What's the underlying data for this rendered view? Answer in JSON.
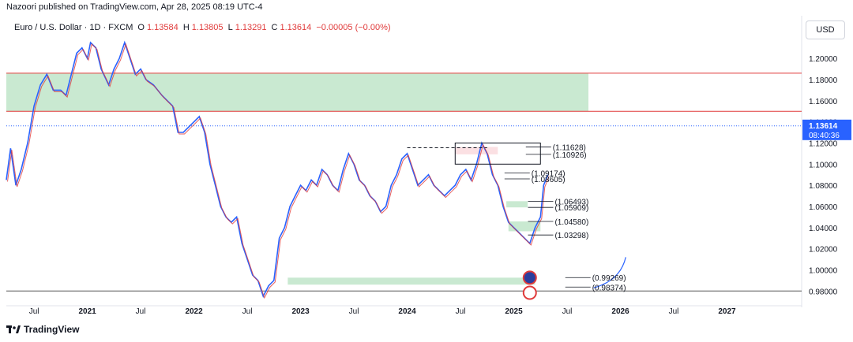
{
  "publisher_line": "Nazoori published on TradingView.com, Apr 28, 2025 08:19 UTC-4",
  "legend": {
    "symbol": "Euro / U.S. Dollar · 1D · FXCM",
    "o_label": "O",
    "o_val": "1.13584",
    "h_label": "H",
    "h_val": "1.13805",
    "l_label": "L",
    "l_val": "1.13291",
    "c_label": "C",
    "c_val": "1.13614",
    "change": "−0.00005 (−0.00%)"
  },
  "currency_button": "USD",
  "branding": "TradingView",
  "colors": {
    "up": "#2962ff",
    "down": "#e03a3a",
    "zone_green": "#b7e1c1",
    "zone_pink": "#f9d6d9",
    "line_red": "#e03a3a",
    "last_price_bg": "#2962ff"
  },
  "chart_data": {
    "type": "line",
    "ylim": [
      0.972,
      1.218
    ],
    "y_ticks": [
      "1.20000",
      "1.18000",
      "1.16000",
      "1.14000",
      "1.12000",
      "1.10000",
      "1.08000",
      "1.06000",
      "1.04000",
      "1.02000",
      "1.00000",
      "0.98000"
    ],
    "y_tick_values": [
      1.2,
      1.18,
      1.16,
      1.14,
      1.12,
      1.1,
      1.08,
      1.06,
      1.04,
      1.02,
      1.0,
      0.98
    ],
    "x_ticks": [
      "Jul",
      "2021",
      "Jul",
      "2022",
      "Jul",
      "2023",
      "Jul",
      "2024",
      "Jul",
      "2025",
      "Jul",
      "2026",
      "Jul",
      "2027"
    ],
    "x_tick_values": [
      2020.5,
      2021.0,
      2021.5,
      2022.0,
      2022.5,
      2023.0,
      2023.5,
      2024.0,
      2024.5,
      2025.0,
      2025.5,
      2026.0,
      2026.5,
      2027.0
    ],
    "xlim": [
      2020.24,
      2027.7
    ],
    "series": [
      {
        "x": [
          2020.24,
          2020.28,
          2020.33,
          2020.38,
          2020.44,
          2020.5,
          2020.56,
          2020.62,
          2020.68,
          2020.75,
          2020.8,
          2020.85,
          2020.9,
          2020.95,
          2021.0,
          2021.03,
          2021.08,
          2021.13,
          2021.2,
          2021.25,
          2021.3,
          2021.35,
          2021.4,
          2021.45,
          2021.5,
          2021.55,
          2021.62,
          2021.7,
          2021.75,
          2021.8,
          2021.85,
          2021.9,
          2021.95,
          2022.0,
          2022.05,
          2022.1,
          2022.15,
          2022.2,
          2022.25,
          2022.3,
          2022.35,
          2022.4,
          2022.45,
          2022.5,
          2022.55,
          2022.6,
          2022.65,
          2022.7,
          2022.75,
          2022.8,
          2022.85,
          2022.9,
          2022.95,
          2023.0,
          2023.05,
          2023.1,
          2023.15,
          2023.2,
          2023.25,
          2023.3,
          2023.35,
          2023.4,
          2023.45,
          2023.5,
          2023.55,
          2023.6,
          2023.65,
          2023.7,
          2023.75,
          2023.8,
          2023.85,
          2023.9,
          2023.95,
          2024.0,
          2024.05,
          2024.1,
          2024.15,
          2024.2,
          2024.25,
          2024.3,
          2024.35,
          2024.4,
          2024.45,
          2024.5,
          2024.55,
          2024.6,
          2024.65,
          2024.7,
          2024.75,
          2024.8,
          2024.85,
          2024.9,
          2024.95,
          2025.0,
          2025.05,
          2025.1,
          2025.15,
          2025.2,
          2025.25,
          2025.28,
          2025.32
        ],
        "y": [
          1.085,
          1.115,
          1.08,
          1.095,
          1.12,
          1.155,
          1.175,
          1.185,
          1.17,
          1.17,
          1.165,
          1.185,
          1.205,
          1.21,
          1.2,
          1.215,
          1.21,
          1.19,
          1.175,
          1.19,
          1.2,
          1.215,
          1.2,
          1.185,
          1.19,
          1.18,
          1.175,
          1.165,
          1.16,
          1.155,
          1.13,
          1.13,
          1.135,
          1.14,
          1.145,
          1.13,
          1.1,
          1.08,
          1.06,
          1.05,
          1.045,
          1.05,
          1.025,
          1.01,
          0.995,
          0.99,
          0.975,
          0.985,
          0.99,
          1.03,
          1.04,
          1.06,
          1.07,
          1.08,
          1.075,
          1.085,
          1.08,
          1.095,
          1.09,
          1.08,
          1.075,
          1.095,
          1.11,
          1.1,
          1.085,
          1.08,
          1.07,
          1.065,
          1.055,
          1.06,
          1.08,
          1.09,
          1.105,
          1.11,
          1.095,
          1.08,
          1.085,
          1.09,
          1.08,
          1.075,
          1.07,
          1.075,
          1.08,
          1.09,
          1.095,
          1.085,
          1.1,
          1.12,
          1.11,
          1.09,
          1.08,
          1.06,
          1.045,
          1.04,
          1.035,
          1.03,
          1.025,
          1.04,
          1.05,
          1.08,
          1.09
        ]
      }
    ],
    "zones": [
      {
        "kind": "green",
        "y_top": 1.186,
        "y_bottom": 1.15
      },
      {
        "kind": "green",
        "y_top": 0.9926,
        "y_bottom": 0.986
      },
      {
        "kind": "green",
        "y_top": 1.06493,
        "y_bottom": 1.05909
      },
      {
        "kind": "green",
        "y_top": 1.0458,
        "y_bottom": 1.0365
      },
      {
        "kind": "pink",
        "y_top": 1.11628,
        "y_bottom": 1.10926
      }
    ],
    "levels": [
      {
        "value": 1.186,
        "kind": "red-line"
      },
      {
        "value": 1.15,
        "kind": "red-line"
      },
      {
        "value": 0.98,
        "kind": "gray-line"
      }
    ],
    "level_labels": [
      {
        "text": "(1.11628)",
        "value": 1.11628
      },
      {
        "text": "(1.10926)",
        "value": 1.10926
      },
      {
        "text": "(1.09174)",
        "value": 1.09174
      },
      {
        "text": "(1.08605)",
        "value": 1.08605
      },
      {
        "text": "(1.06493)",
        "value": 1.06493
      },
      {
        "text": "(1.05909)",
        "value": 1.05909
      },
      {
        "text": "(1.04580)",
        "value": 1.0458
      },
      {
        "text": "(1.03298)",
        "value": 1.03298
      },
      {
        "text": "(0.99269)",
        "value": 0.99269
      },
      {
        "text": "(0.98374)",
        "value": 0.98374
      }
    ],
    "last_price": {
      "value": 1.13614,
      "label": "1.13614",
      "countdown": "08:40:36"
    }
  }
}
